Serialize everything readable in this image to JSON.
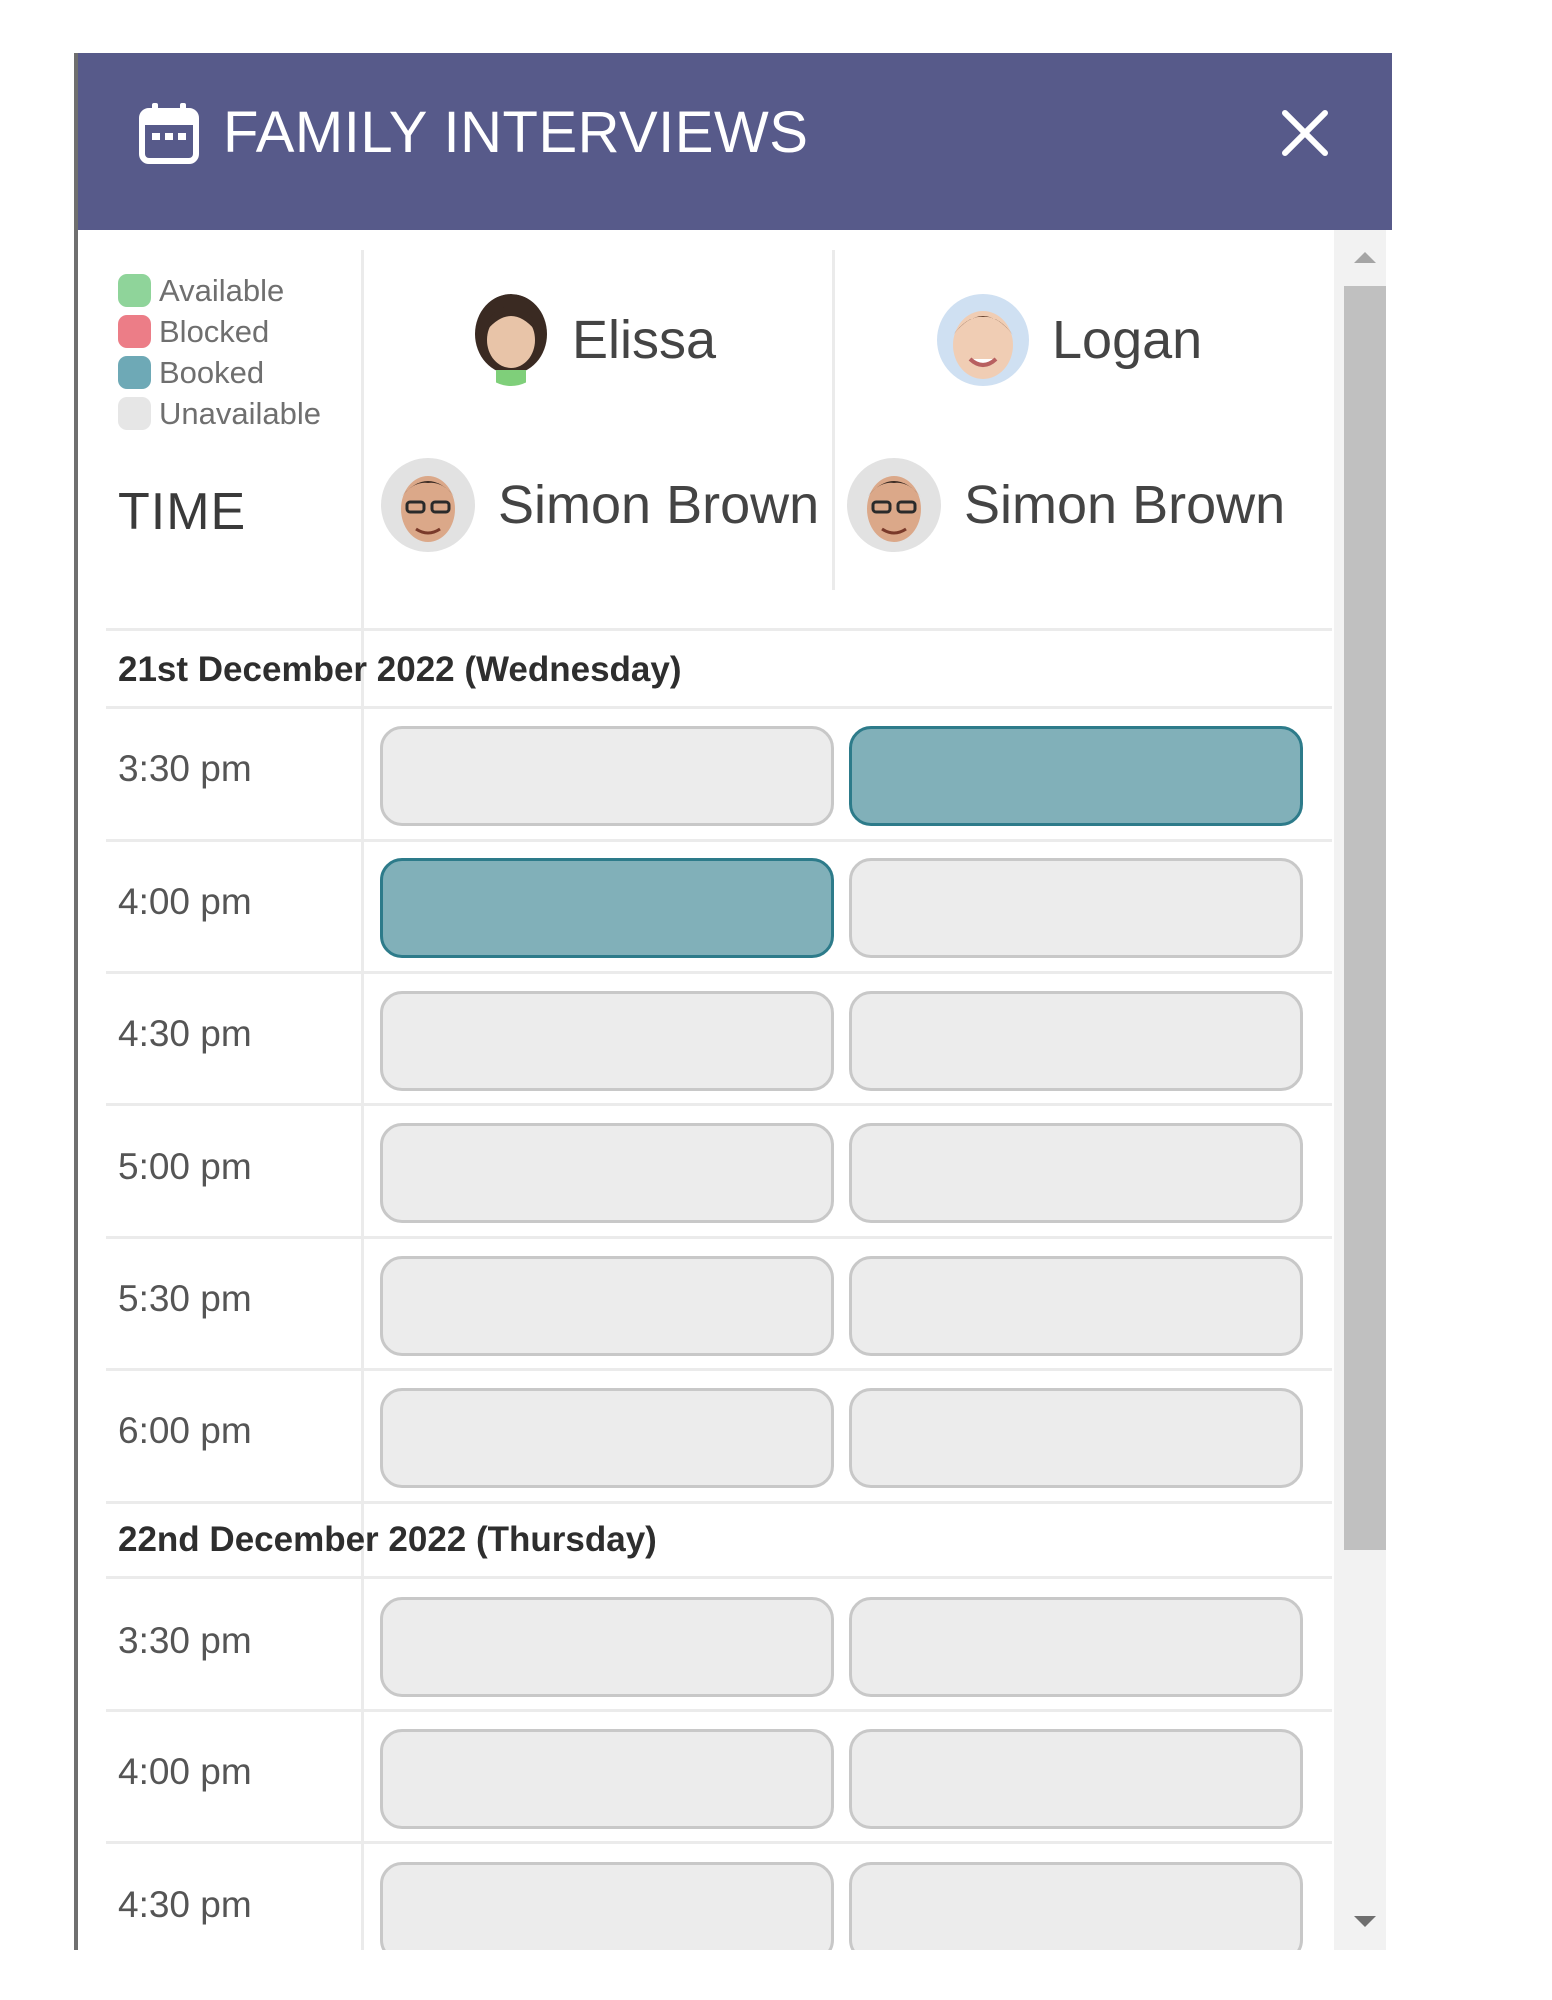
{
  "dialog": {
    "title": "FAMILY INTERVIEWS",
    "icon": "calendar-icon",
    "close_icon": "close-icon"
  },
  "legend": [
    {
      "label": "Available",
      "color": "#8fd49a"
    },
    {
      "label": "Blocked",
      "color": "#ec7d87"
    },
    {
      "label": "Booked",
      "color": "#6ea9b6"
    },
    {
      "label": "Unavailable",
      "color": "#e6e6e6"
    }
  ],
  "time_header": "TIME",
  "columns": [
    {
      "student": "Elissa",
      "teacher": "Simon Brown"
    },
    {
      "student": "Logan",
      "teacher": "Simon Brown"
    }
  ],
  "colors": {
    "header": "#575a8a",
    "booked_fill": "#81b0b9",
    "booked_border": "#2d7b8a",
    "unavailable_fill": "#ececec"
  },
  "days": [
    {
      "date": "21st December 2022 (Wednesday)",
      "slots": [
        {
          "time": "3:30 pm",
          "status": [
            "unavailable",
            "booked"
          ]
        },
        {
          "time": "4:00 pm",
          "status": [
            "booked",
            "unavailable"
          ]
        },
        {
          "time": "4:30 pm",
          "status": [
            "unavailable",
            "unavailable"
          ]
        },
        {
          "time": "5:00 pm",
          "status": [
            "unavailable",
            "unavailable"
          ]
        },
        {
          "time": "5:30 pm",
          "status": [
            "unavailable",
            "unavailable"
          ]
        },
        {
          "time": "6:00 pm",
          "status": [
            "unavailable",
            "unavailable"
          ]
        }
      ]
    },
    {
      "date": "22nd December 2022 (Thursday)",
      "slots": [
        {
          "time": "3:30 pm",
          "status": [
            "unavailable",
            "unavailable"
          ]
        },
        {
          "time": "4:00 pm",
          "status": [
            "unavailable",
            "unavailable"
          ]
        },
        {
          "time": "4:30 pm",
          "status": [
            "unavailable",
            "unavailable"
          ]
        }
      ]
    }
  ]
}
